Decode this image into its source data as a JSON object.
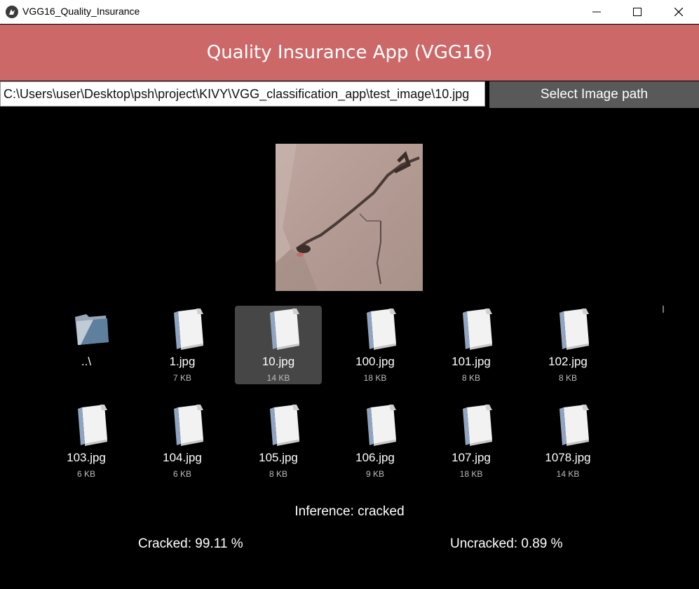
{
  "window": {
    "title": "VGG16_Quality_Insurance",
    "minimize_glyph": "—",
    "maximize_glyph": "☐",
    "close_glyph": "✕"
  },
  "header": {
    "title": "Quality Insurance App (VGG16)",
    "bg_color": "#cd6868"
  },
  "path_bar": {
    "value": "C:\\Users\\user\\Desktop\\psh\\project\\KIVY\\VGG_classification_app\\test_image\\10.jpg",
    "button_label": "Select Image path"
  },
  "preview": {
    "icon": "concrete-crack-image"
  },
  "files": [
    {
      "name": "..\\",
      "size": "",
      "type": "folder",
      "selected": false
    },
    {
      "name": "1.jpg",
      "size": "7 KB",
      "type": "file",
      "selected": false
    },
    {
      "name": "10.jpg",
      "size": "14 KB",
      "type": "file",
      "selected": true
    },
    {
      "name": "100.jpg",
      "size": "18 KB",
      "type": "file",
      "selected": false
    },
    {
      "name": "101.jpg",
      "size": "8 KB",
      "type": "file",
      "selected": false
    },
    {
      "name": "102.jpg",
      "size": "8 KB",
      "type": "file",
      "selected": false
    },
    {
      "name": "103.jpg",
      "size": "6 KB",
      "type": "file",
      "selected": false
    },
    {
      "name": "104.jpg",
      "size": "6 KB",
      "type": "file",
      "selected": false
    },
    {
      "name": "105.jpg",
      "size": "8 KB",
      "type": "file",
      "selected": false
    },
    {
      "name": "106.jpg",
      "size": "9 KB",
      "type": "file",
      "selected": false
    },
    {
      "name": "107.jpg",
      "size": "18 KB",
      "type": "file",
      "selected": false
    },
    {
      "name": "1078.jpg",
      "size": "14 KB",
      "type": "file",
      "selected": false
    }
  ],
  "result": {
    "inference": "Inference: cracked",
    "cracked": "Cracked: 99.11 %",
    "uncracked": "Uncracked: 0.89 %"
  }
}
